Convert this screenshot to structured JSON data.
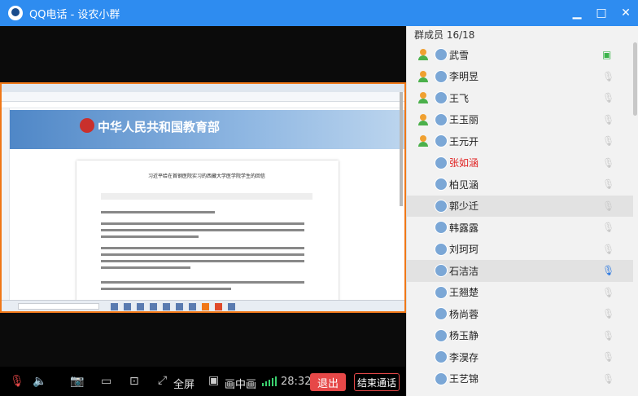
{
  "window": {
    "title": "QQ电话 - 设农小群",
    "minimize_icon": "minimize-icon",
    "restore_icon": "restore-icon",
    "close_icon": "close-icon"
  },
  "members": {
    "header": "群成员 16/18",
    "list": [
      {
        "name": "武雪",
        "status": "screen-share-icon"
      },
      {
        "name": "李明昱",
        "status": "mic-muted-icon"
      },
      {
        "name": "王飞",
        "status": "mic-muted-icon"
      },
      {
        "name": "王玉丽",
        "status": "mic-muted-icon"
      },
      {
        "name": "王元开",
        "status": "mic-muted-icon"
      },
      {
        "name": "张如涵",
        "status": "mic-muted-icon"
      },
      {
        "name": "柏见涵",
        "status": "mic-muted-icon"
      },
      {
        "name": "郭少迁",
        "status": "mic-muted-icon"
      },
      {
        "name": "韩露露",
        "status": "mic-muted-icon"
      },
      {
        "name": "刘珂珂",
        "status": "mic-muted-icon"
      },
      {
        "name": "石洁洁",
        "status": "mic-on-icon"
      },
      {
        "name": "王翘楚",
        "status": "mic-muted-icon"
      },
      {
        "name": "杨尚蓉",
        "status": "mic-muted-icon"
      },
      {
        "name": "杨玉静",
        "status": "mic-muted-icon"
      },
      {
        "name": "李淏存",
        "status": "mic-muted-icon"
      },
      {
        "name": "王艺锦",
        "status": "mic-muted-icon"
      }
    ]
  },
  "shared_screen": {
    "site_title": "中华人民共和国教育部",
    "article_title": "习近平给在首钢医院实习的西藏大学医学院学生的回信"
  },
  "toolbar": {
    "fullscreen_label": "全屏",
    "pip_label": "画中画",
    "timer": "28:32",
    "exit_label": "退出",
    "end_call_label": "结束通话"
  },
  "colors": {
    "title_bar": "#2e8cf0",
    "exit_button": "#e64848",
    "active_mic": "#2e7ae0",
    "host_badge": "#4bb04b"
  }
}
